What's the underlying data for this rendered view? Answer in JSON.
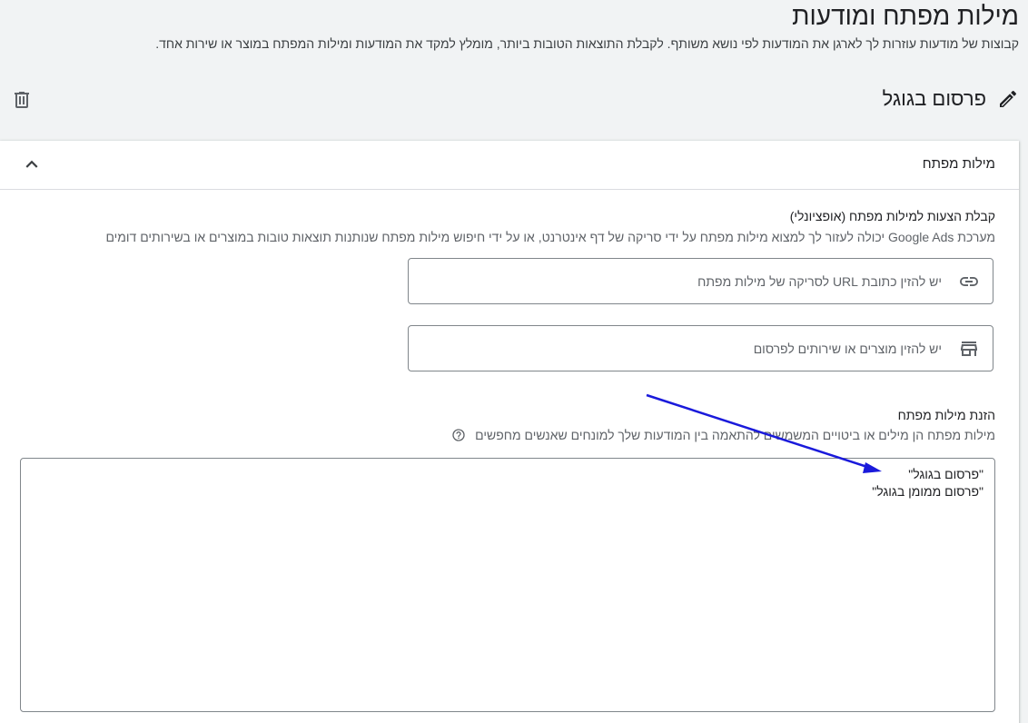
{
  "page": {
    "title": "מילות מפתח ומודעות",
    "subtitle": "קבוצות של מודעות עוזרות לך לארגן את המודעות לפי נושא משותף. לקבלת התוצאות הטובות ביותר, מומלץ למקד את המודעות ומילות המפתח במוצר או שירות אחד."
  },
  "ad_group": {
    "name": "פרסום בגוגל",
    "edit_icon": "pencil-icon",
    "delete_icon": "trash-icon"
  },
  "keywords_panel": {
    "header": "מילות מפתח",
    "collapse_icon": "chevron-up-icon",
    "suggestions": {
      "title": "קבלת הצעות למילות מפתח (אופציונלי)",
      "description": "מערכת Google Ads יכולה לעזור לך למצוא מילות מפתח על ידי סריקה של דף אינטרנט, או על ידי חיפוש מילות מפתח שנותנות תוצאות טובות במוצרים או בשירותים דומים",
      "url_input": {
        "placeholder": "יש להזין כתובת URL לסריקה של מילות מפתח",
        "value": "",
        "icon": "link-icon"
      },
      "products_input": {
        "placeholder": "יש להזין מוצרים או שירותים לפרסום",
        "value": "",
        "icon": "store-icon"
      }
    },
    "enter_keywords": {
      "title": "הזנת מילות מפתח",
      "description": "מילות מפתח הן מילים או ביטויים המשמשים להתאמה בין המודעות שלך למונחים שאנשים מחפשים",
      "help_icon": "help-circle-icon",
      "value": "\"פרסום בגוגל\"\n\"פרסום ממומן בגוגל\""
    }
  },
  "annotation": {
    "arrow_color": "#1a1adb"
  }
}
